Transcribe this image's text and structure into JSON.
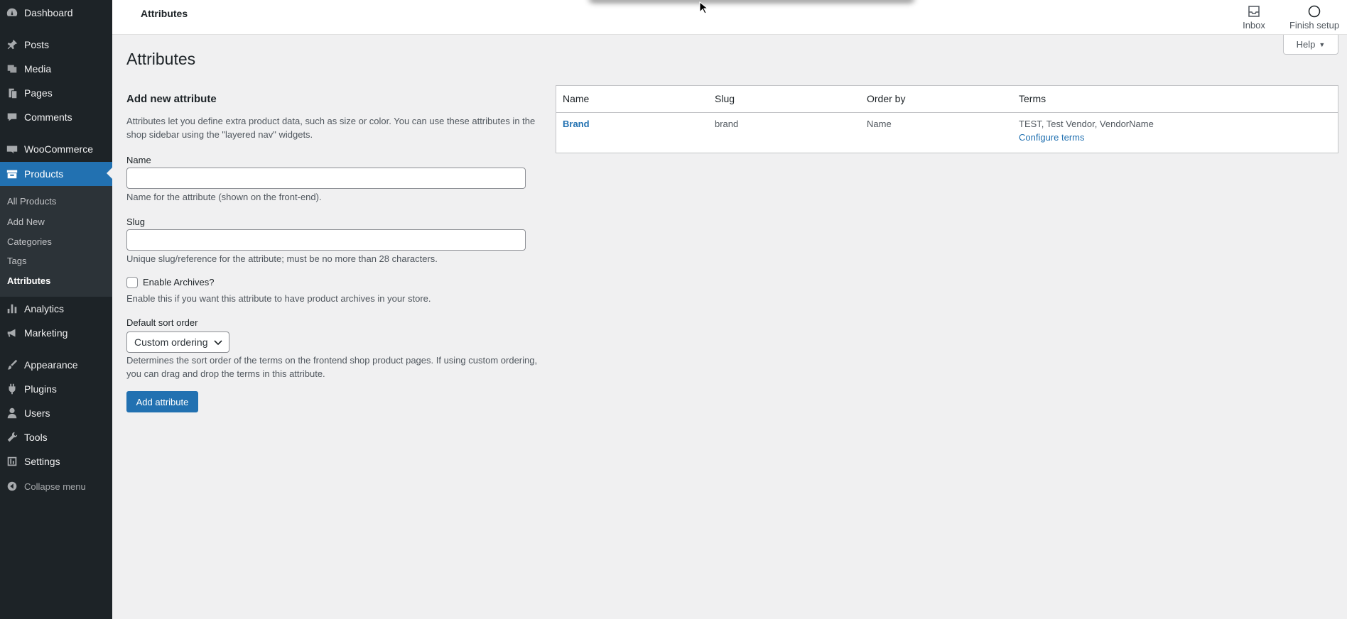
{
  "sidebar": {
    "items": [
      {
        "label": "Dashboard",
        "icon": "dashboard-icon"
      },
      {
        "label": "Posts",
        "icon": "pin-icon"
      },
      {
        "label": "Media",
        "icon": "media-icon"
      },
      {
        "label": "Pages",
        "icon": "pages-icon"
      },
      {
        "label": "Comments",
        "icon": "comments-icon"
      },
      {
        "label": "WooCommerce",
        "icon": "woocommerce-icon"
      },
      {
        "label": "Products",
        "icon": "archive-icon"
      },
      {
        "label": "Analytics",
        "icon": "chart-bar-icon"
      },
      {
        "label": "Marketing",
        "icon": "megaphone-icon"
      },
      {
        "label": "Appearance",
        "icon": "brush-icon"
      },
      {
        "label": "Plugins",
        "icon": "plug-icon"
      },
      {
        "label": "Users",
        "icon": "user-icon"
      },
      {
        "label": "Tools",
        "icon": "wrench-icon"
      },
      {
        "label": "Settings",
        "icon": "settings-icon"
      },
      {
        "label": "Collapse menu",
        "icon": "collapse-icon"
      }
    ],
    "submenu": [
      "All Products",
      "Add New",
      "Categories",
      "Tags",
      "Attributes"
    ]
  },
  "topbar": {
    "title": "Attributes",
    "inbox_label": "Inbox",
    "finish_setup_label": "Finish setup"
  },
  "help_label": "Help",
  "page": {
    "title": "Attributes",
    "form": {
      "heading": "Add new attribute",
      "intro": "Attributes let you define extra product data, such as size or color. You can use these attributes in the shop sidebar using the \"layered nav\" widgets.",
      "name_label": "Name",
      "name_value": "",
      "name_help": "Name for the attribute (shown on the front-end).",
      "slug_label": "Slug",
      "slug_value": "",
      "slug_help": "Unique slug/reference for the attribute; must be no more than 28 characters.",
      "archives_label": "Enable Archives?",
      "archives_checked": false,
      "archives_help": "Enable this if you want this attribute to have product archives in your store.",
      "sort_label": "Default sort order",
      "sort_value": "Custom ordering",
      "sort_help": "Determines the sort order of the terms on the frontend shop product pages. If using custom ordering, you can drag and drop the terms in this attribute.",
      "submit_label": "Add attribute"
    },
    "table": {
      "headers": [
        "Name",
        "Slug",
        "Order by",
        "Terms"
      ],
      "rows": [
        {
          "name": "Brand",
          "slug": "brand",
          "order_by": "Name",
          "terms": "TEST, Test Vendor, VendorName",
          "configure_link": "Configure terms"
        }
      ]
    }
  },
  "colors": {
    "sidebar_bg": "#1d2327",
    "accent": "#2271b1",
    "page_bg": "#f0f0f1"
  }
}
